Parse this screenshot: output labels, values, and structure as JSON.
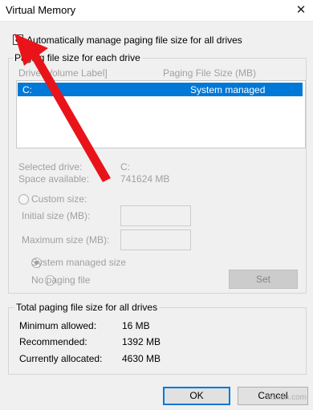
{
  "window": {
    "title": "Virtual Memory",
    "close_glyph": "✕"
  },
  "auto_manage": {
    "label": "Automatically manage paging file size for all drives",
    "checked": true
  },
  "paging_group": {
    "legend": "Paging file size for each drive",
    "col_drive": "Drive [Volume Label]",
    "col_size": "Paging File Size (MB)",
    "rows": [
      {
        "drive": "C:",
        "size": "System managed"
      }
    ]
  },
  "selected": {
    "drive_label": "Selected drive:",
    "drive_value": "C:",
    "space_label": "Space available:",
    "space_value": "741624 MB"
  },
  "custom": {
    "radio_label": "Custom size:",
    "initial_label": "Initial size (MB):",
    "maximum_label": "Maximum size (MB):"
  },
  "system_managed_label": "System managed size",
  "no_paging_label": "No paging file",
  "set_label": "Set",
  "totals": {
    "legend": "Total paging file size for all drives",
    "min_label": "Minimum allowed:",
    "min_value": "16 MB",
    "rec_label": "Recommended:",
    "rec_value": "1392 MB",
    "cur_label": "Currently allocated:",
    "cur_value": "4630 MB"
  },
  "ok_label": "OK",
  "cancel_label": "Cancel",
  "watermark": "wsxdn.com",
  "colors": {
    "selection": "#0078d7",
    "arrow": "#e8141a"
  }
}
